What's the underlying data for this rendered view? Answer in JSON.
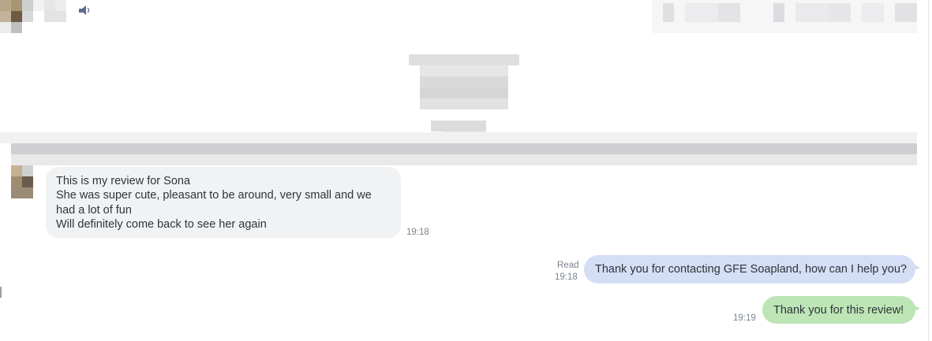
{
  "header": {
    "sound_icon": "speaker-icon"
  },
  "messages": {
    "incoming": {
      "lines": [
        "This is my review for Sona",
        "She was super cute, pleasant to be around, very small and we",
        "had a lot of fun",
        "Will definitely come back to see her again"
      ],
      "time": "19:18"
    },
    "outgoing_1": {
      "text": "Thank you for contacting GFE Soapland, how can I help you?",
      "status": "Read",
      "time": "19:18"
    },
    "outgoing_2": {
      "text": "Thank you for this review!",
      "time": "19:19"
    }
  },
  "colors": {
    "incoming_bubble": "#f1f2f4",
    "outgoing_blue_bubble": "#d4def5",
    "outgoing_green_bubble": "#bde5b6",
    "timestamp": "#7d848c"
  }
}
